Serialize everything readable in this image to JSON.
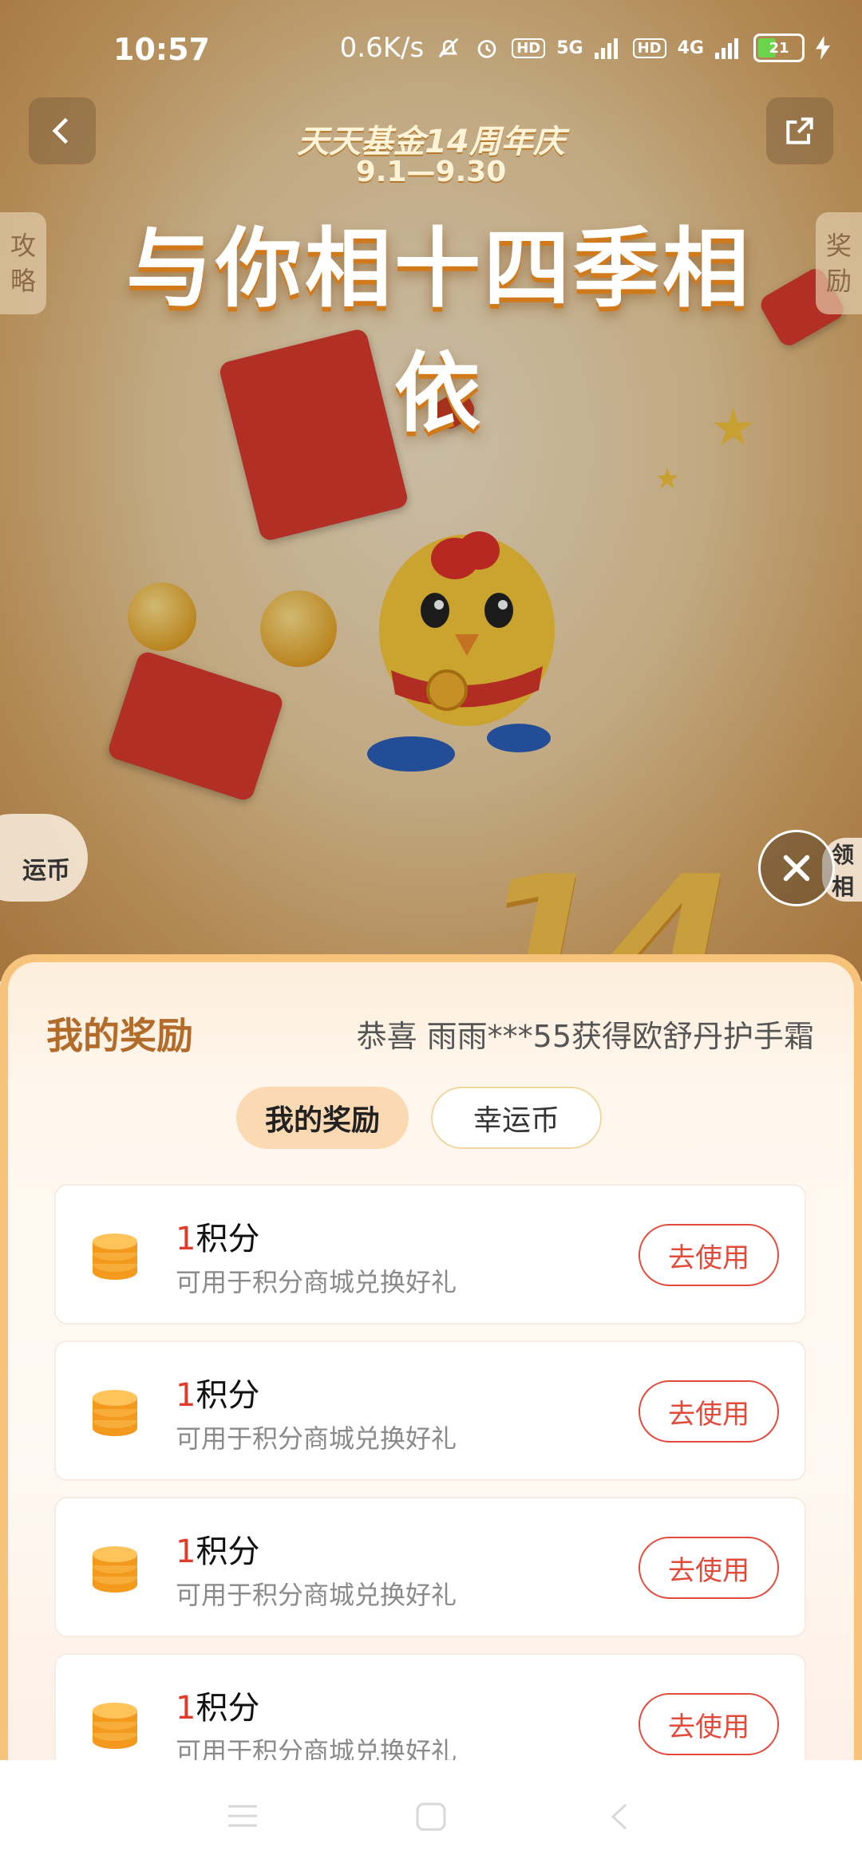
{
  "status_bar": {
    "time": "10:57",
    "network_speed": "0.6K/s",
    "hd_badge_1": "HD",
    "signal_1": "5G",
    "hd_badge_2": "HD",
    "signal_2": "4G",
    "battery_level": "21"
  },
  "banner": {
    "event_subtitle": "天天基金14周年庆",
    "event_dates": "9.1—9.30",
    "event_title": "与你相十四季相依",
    "left_side_tab": "攻略",
    "right_side_tab": "奖励",
    "left_bubble_label": "运币",
    "right_bubble_label": "领相"
  },
  "sheet": {
    "title": "我的奖励",
    "notice": "恭喜 雨雨***55获得欧舒丹护手霜",
    "tabs": [
      {
        "label": "我的奖励",
        "active": true
      },
      {
        "label": "幸运币",
        "active": false
      }
    ],
    "rewards": [
      {
        "amount": "1",
        "unit": "积分",
        "description": "可用于积分商城兑换好礼",
        "button": "去使用"
      },
      {
        "amount": "1",
        "unit": "积分",
        "description": "可用于积分商城兑换好礼",
        "button": "去使用"
      },
      {
        "amount": "1",
        "unit": "积分",
        "description": "可用于积分商城兑换好礼",
        "button": "去使用"
      },
      {
        "amount": "1",
        "unit": "积分",
        "description": "可用于积分商城兑换好礼",
        "button": "去使用"
      }
    ]
  },
  "colors": {
    "accent_red": "#e24a3a",
    "title_brown": "#b36b2a",
    "coin_orange": "#f39a1e"
  },
  "icons": [
    "back-arrow-icon",
    "share-icon",
    "close-icon",
    "coin-stack-icon",
    "menu-nav-icon",
    "home-nav-icon",
    "back-nav-icon"
  ]
}
